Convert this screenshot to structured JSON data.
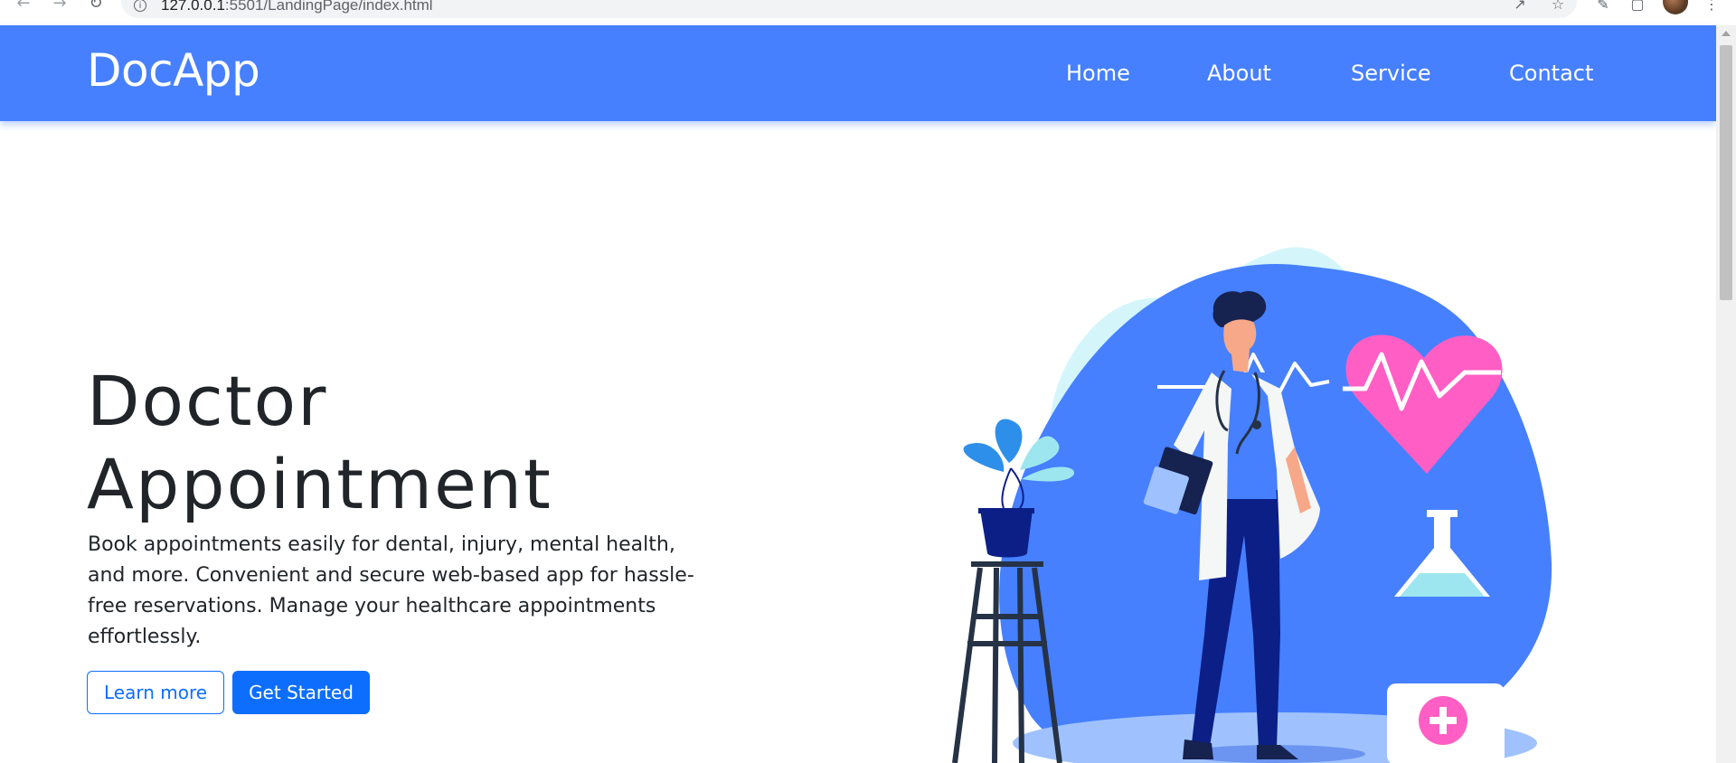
{
  "browser": {
    "url_host": "127.0.0.1",
    "url_rest": ":5501/LandingPage/index.html"
  },
  "navbar": {
    "brand": "DocApp",
    "links": [
      "Home",
      "About",
      "Service",
      "Contact"
    ]
  },
  "hero": {
    "title_line1": "Doctor",
    "title_line2": "Appointment",
    "description": "Book appointments easily for dental, injury, mental health, and more. Convenient and secure web-based app for hassle-free reservations. Manage your healthcare appointments effortlessly.",
    "learn_more_label": "Learn more",
    "get_started_label": "Get Started"
  },
  "illustration": {
    "name": "doctor-illustration",
    "elements": [
      "doctor-figure",
      "heart-icon",
      "stethoscope-icon",
      "flask-icon",
      "first-aid-kit-icon",
      "potted-plant",
      "stool",
      "clipboard"
    ]
  },
  "colors": {
    "primary": "#4680ff",
    "button_blue": "#0d6efd",
    "heart_pink": "#ff5ec4",
    "light_cyan": "#d4f6fb",
    "navy": "#0c1f86"
  }
}
